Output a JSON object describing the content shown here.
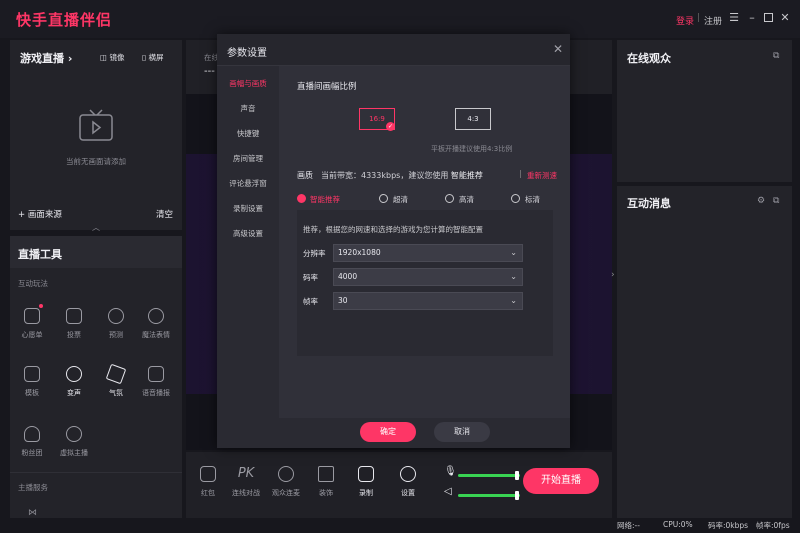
{
  "app": {
    "title": "快手直播伴侣"
  },
  "titlebar": {
    "login": "登录",
    "separator": "|",
    "register": "注册"
  },
  "left_top": {
    "title": "游戏直播",
    "mirror": "镜像",
    "landscape": "横屏",
    "empty_text": "当前无画面请添加",
    "add_source": "+ 画面来源",
    "clear": "清空"
  },
  "tools": {
    "title": "直播工具",
    "section_interactive": "互动玩法",
    "items": [
      {
        "label": "心愿单"
      },
      {
        "label": "投票"
      },
      {
        "label": "预测"
      },
      {
        "label": "魔法表情"
      },
      {
        "label": "模板"
      },
      {
        "label": "变声"
      },
      {
        "label": "气氛"
      },
      {
        "label": "语音播报"
      },
      {
        "label": "粉丝团"
      },
      {
        "label": "虚拟主播"
      }
    ],
    "section_service": "主播服务"
  },
  "center": {
    "header_label": "在线",
    "header_value": "---",
    "bottom_items": [
      {
        "label": "红包"
      },
      {
        "label": "连线对战"
      },
      {
        "label": "观众连麦"
      },
      {
        "label": "装饰"
      },
      {
        "label": "录制"
      },
      {
        "label": "设置"
      }
    ],
    "start_live": "开始直播",
    "mic_level": 0.95,
    "speaker_level": 0.95
  },
  "right": {
    "online_title": "在线观众",
    "messages_title": "互动消息"
  },
  "statusbar": {
    "network": "网络:--",
    "cpu": "CPU:0%",
    "bitrate": "码率:0kbps",
    "framerate": "帧率:0fps"
  },
  "modal": {
    "title": "参数设置",
    "sidebar": [
      "画幅与画质",
      "声音",
      "快捷键",
      "房间管理",
      "评论悬浮窗",
      "录制设置",
      "高级设置"
    ],
    "ratio_title": "直播间画幅比例",
    "ratio_options": [
      "16:9",
      "4:3"
    ],
    "ratio_hint": "平板开播建议使用4:3比例",
    "quality_label": "画质",
    "bandwidth_text": "当前带宽：4333kbps，建议您使用",
    "bandwidth_recommend": "智能推荐",
    "retest": "重新测速",
    "quality_options": [
      "智能推荐",
      "超清",
      "高清",
      "标清"
    ],
    "recommend_desc": "推荐，根据您的网速和选择的游戏为您计算的智能配置",
    "resolution_label": "分辨率",
    "resolution_value": "1920x1080",
    "bitrate_label": "码率",
    "bitrate_value": "4000",
    "fps_label": "帧率",
    "fps_value": "30",
    "confirm": "确定",
    "cancel": "取消"
  },
  "colors": {
    "accent": "#fe3666",
    "slider": "#39d353"
  }
}
